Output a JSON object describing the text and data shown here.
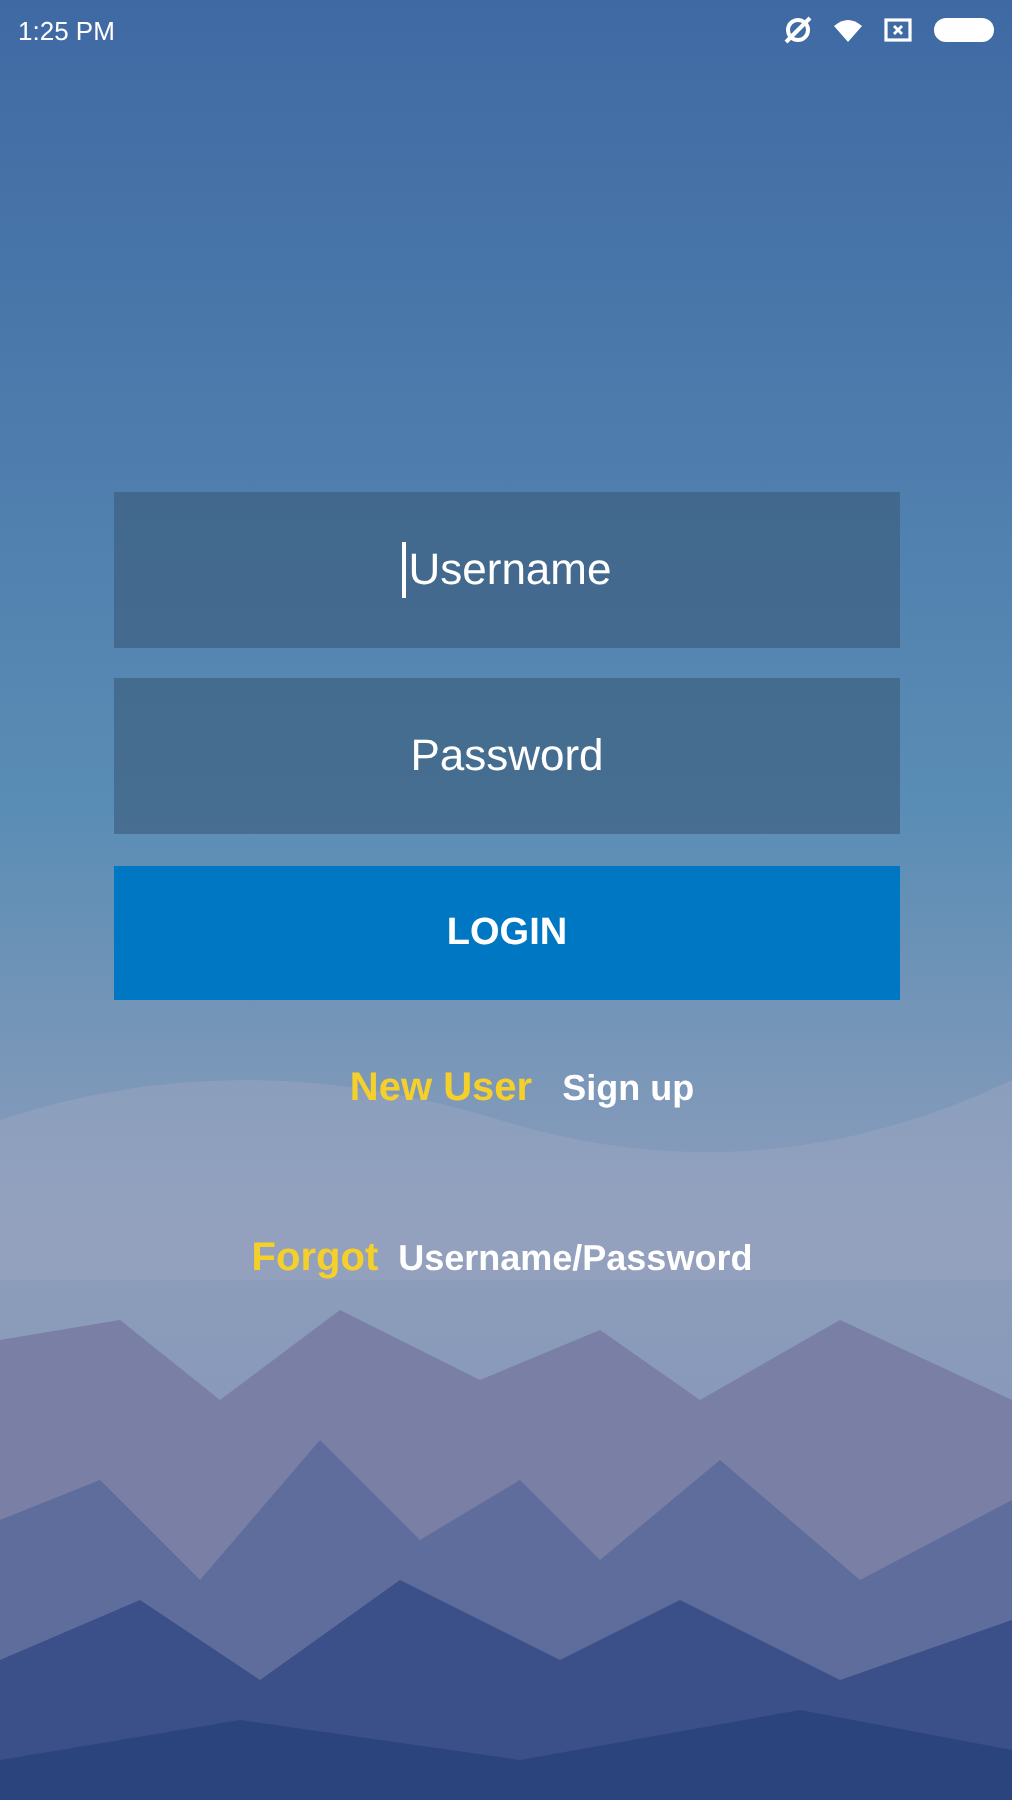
{
  "status_bar": {
    "time": "1:25 PM"
  },
  "fields": [
    {
      "placeholder": "Username",
      "focused": true
    },
    {
      "placeholder": "Password",
      "focused": false
    }
  ],
  "login_button": "LOGIN",
  "links": [
    {
      "prompt": "New User",
      "action": "Sign up"
    },
    {
      "prompt": "Forgot",
      "action": "Username/Password"
    }
  ]
}
